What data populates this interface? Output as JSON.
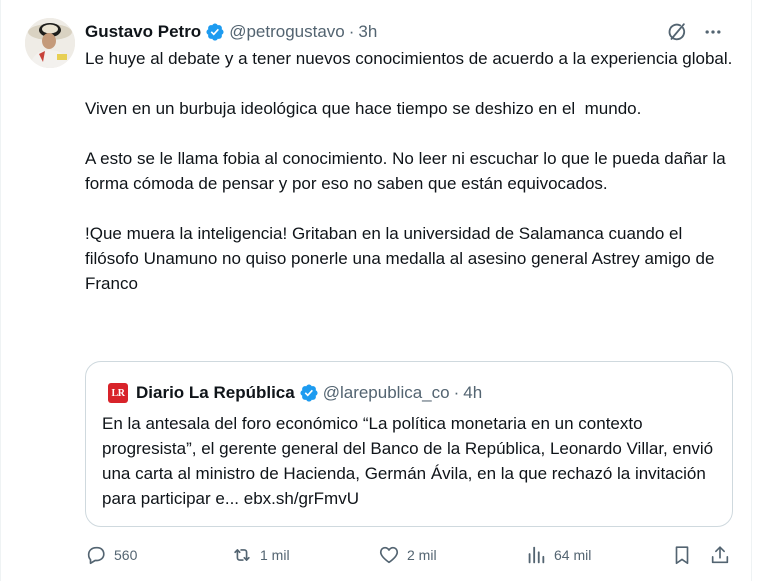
{
  "author": {
    "display_name": "Gustavo Petro",
    "handle": "@petrogustavo",
    "separator": "·",
    "time": "3h",
    "avatar_icon": "avatar-photo",
    "verified_color": "#1d9bf0"
  },
  "header_actions": {
    "grok_icon": "grok-icon",
    "more_icon": "more-icon"
  },
  "tweet_text": "Le huye al debate y a tener nuevos conocimientos de acuerdo a la experiencia global.\n\nViven en un burbuja ideológica que hace tiempo se deshizo en el  mundo.\n\nA esto se le llama fobia al conocimiento. No leer ni escuchar lo que le pueda dañar la forma cómoda de pensar y por eso no saben que están equivocados.\n\n!Que muera la inteligencia! Gritaban en la universidad de Salamanca cuando el filósofo Unamuno no quiso ponerle una medalla al asesino general Astrey amigo de Franco",
  "quoted": {
    "logo_text": "LR",
    "display_name": "Diario La República",
    "handle": "@larepublica_co",
    "separator": "·",
    "time": "4h",
    "text": "En la antesala del foro económico “La política monetaria en un contexto progresista”, el gerente general del Banco de la República, Leonardo Villar, envió una carta al ministro de Hacienda, Germán Ávila, en la que rechazó la invitación para participar e... ebx.sh/grFmvU"
  },
  "actions": {
    "replies": "560",
    "reposts": "1 mil",
    "likes": "2 mil",
    "views": "64 mil",
    "bookmark_icon": "bookmark-icon",
    "share_icon": "share-icon"
  },
  "colors": {
    "text": "#0f1419",
    "secondary": "#536471",
    "border": "#cfd9de",
    "brand_red": "#d8232a"
  }
}
